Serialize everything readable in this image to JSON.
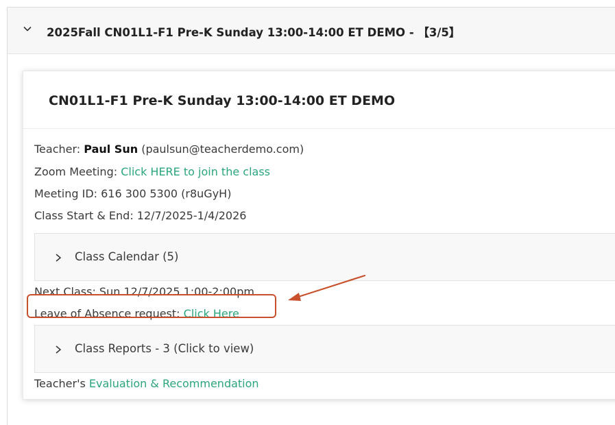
{
  "accordion": {
    "title": "2025Fall CN01L1-F1 Pre-K Sunday 13:00-14:00 ET DEMO - 【3/5】"
  },
  "card": {
    "title": "CN01L1-F1 Pre-K Sunday 13:00-14:00 ET DEMO",
    "teacher": {
      "label": "Teacher:",
      "name": "Paul Sun",
      "email": "(paulsun@teacherdemo.com)"
    },
    "zoom": {
      "label": "Zoom Meeting:",
      "link_text": "Click HERE to join the class"
    },
    "meeting_id": "Meeting ID: 616 300 5300 (r8uGyH)",
    "class_dates": "Class Start & End: 12/7/2025-1/4/2026",
    "class_calendar": "Class Calendar (5)",
    "next_class": "Next Class: Sun 12/7/2025 1:00-2:00pm",
    "leave": {
      "label": "Leave of Absence request:",
      "link_text": "Click Here"
    },
    "class_reports": "Class Reports - 3 (Click to view)",
    "evaluation": {
      "label": "Teacher's",
      "link_text": "Evaluation & Recommendation"
    }
  },
  "colors": {
    "link": "#2aa57e",
    "annotation": "#c9502c"
  },
  "icons": {
    "accordion": "chevron-down-icon",
    "sub_accordion": "chevron-right-icon",
    "annotation": "arrow-annotation-icon"
  }
}
